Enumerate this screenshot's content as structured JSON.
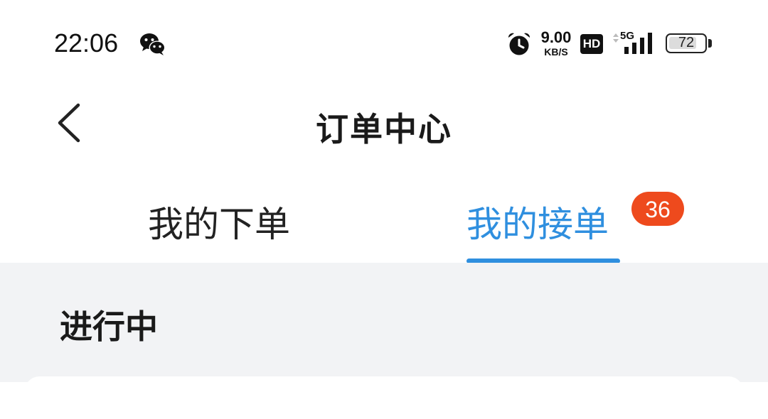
{
  "status_bar": {
    "time": "22:06",
    "net_speed_value": "9.00",
    "net_speed_unit": "KB/S",
    "hd_label": "HD",
    "network_type": "5G",
    "battery_percent": "72",
    "icons": [
      "wechat-icon",
      "alarm-icon",
      "signal-icon",
      "battery-icon"
    ]
  },
  "header": {
    "title": "订单中心",
    "back_icon": "chevron-left-icon"
  },
  "tabs": [
    {
      "label": "我的下单",
      "active": false
    },
    {
      "label": "我的接单",
      "active": true,
      "badge": "36"
    }
  ],
  "main": {
    "section_title": "进行中"
  },
  "colors": {
    "accent": "#2f8fdf",
    "badge": "#ee4a1d",
    "content_bg": "#f2f3f5"
  }
}
